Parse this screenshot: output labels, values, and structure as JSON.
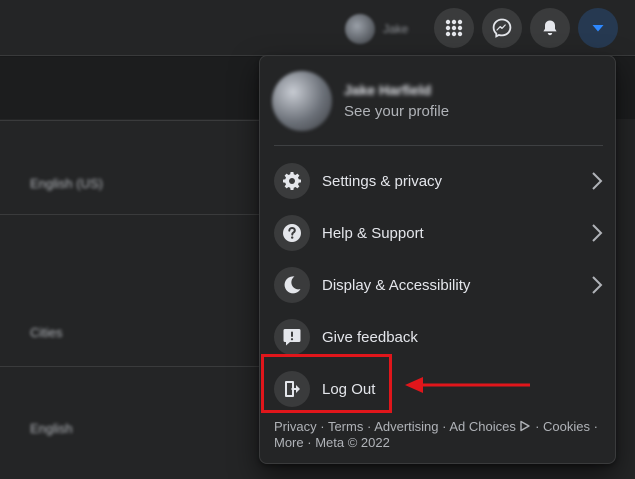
{
  "topbar": {
    "profile_name": "Jake",
    "buttons": [
      "menu-grid",
      "messenger",
      "notifications",
      "account"
    ]
  },
  "background": {
    "rows": [
      "English (US)",
      "Cities",
      "English"
    ]
  },
  "menu": {
    "profile": {
      "name": "Jake Harfield",
      "subtitle": "See your profile"
    },
    "items": [
      {
        "label": "Settings & privacy",
        "icon": "gear-icon",
        "has_arrow": true
      },
      {
        "label": "Help & Support",
        "icon": "question-icon",
        "has_arrow": true
      },
      {
        "label": "Display & Accessibility",
        "icon": "moon-icon",
        "has_arrow": true
      },
      {
        "label": "Give feedback",
        "icon": "feedback-icon",
        "has_arrow": false
      },
      {
        "label": "Log Out",
        "icon": "logout-icon",
        "has_arrow": false
      }
    ],
    "footer": {
      "links": [
        "Privacy",
        "Terms",
        "Advertising",
        "Ad Choices",
        "Cookies",
        "More"
      ],
      "copyright": "Meta © 2022"
    }
  },
  "annotation": {
    "highlight_color": "#e0161b"
  },
  "colors": {
    "background": "#18191a",
    "surface": "#242526",
    "icon_bg": "#3a3b3c",
    "accent": "#2d88ff"
  }
}
